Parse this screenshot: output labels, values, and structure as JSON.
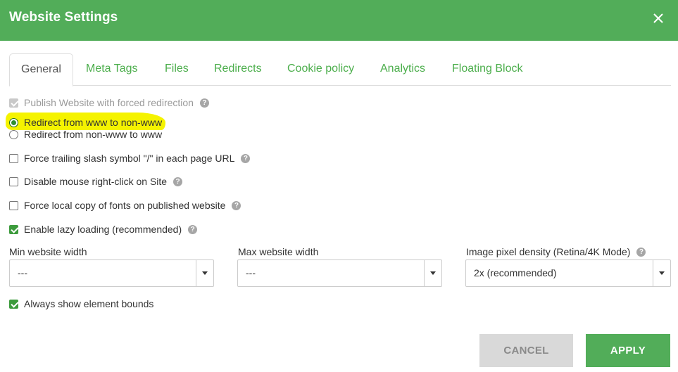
{
  "header": {
    "title": "Website Settings"
  },
  "tabs": [
    {
      "label": "General"
    },
    {
      "label": "Meta Tags"
    },
    {
      "label": "Files"
    },
    {
      "label": "Redirects"
    },
    {
      "label": "Cookie policy"
    },
    {
      "label": "Analytics"
    },
    {
      "label": "Floating Block"
    }
  ],
  "general": {
    "publish_forced": {
      "label": "Publish Website with forced redirection",
      "checked": true,
      "disabled": true
    },
    "redirect_options": [
      {
        "label": "Redirect from www to non-www",
        "selected": true
      },
      {
        "label": "Redirect from non-www to www",
        "selected": false
      }
    ],
    "force_trailing_slash": {
      "label": "Force trailing slash symbol \"/\" in each page URL",
      "checked": false
    },
    "disable_right_click": {
      "label": "Disable mouse right-click on Site",
      "checked": false
    },
    "force_local_fonts": {
      "label": "Force local copy of fonts on published website",
      "checked": false
    },
    "lazy_loading": {
      "label": "Enable lazy loading (recommended)",
      "checked": true
    },
    "min_width": {
      "label": "Min website width",
      "value": "---"
    },
    "max_width": {
      "label": "Max website width",
      "value": "---"
    },
    "pixel_density": {
      "label": "Image pixel density (Retina/4K Mode)",
      "value": "2x (recommended)"
    },
    "always_show_bounds": {
      "label": "Always show element bounds",
      "checked": true
    }
  },
  "footer": {
    "cancel_label": "CANCEL",
    "apply_label": "APPLY"
  },
  "help_glyph": "?",
  "colors": {
    "brand_green": "#52ad59",
    "tab_green": "#4cae4c",
    "highlight": "#f5f300",
    "cancel_bg": "#d9d9d9"
  }
}
